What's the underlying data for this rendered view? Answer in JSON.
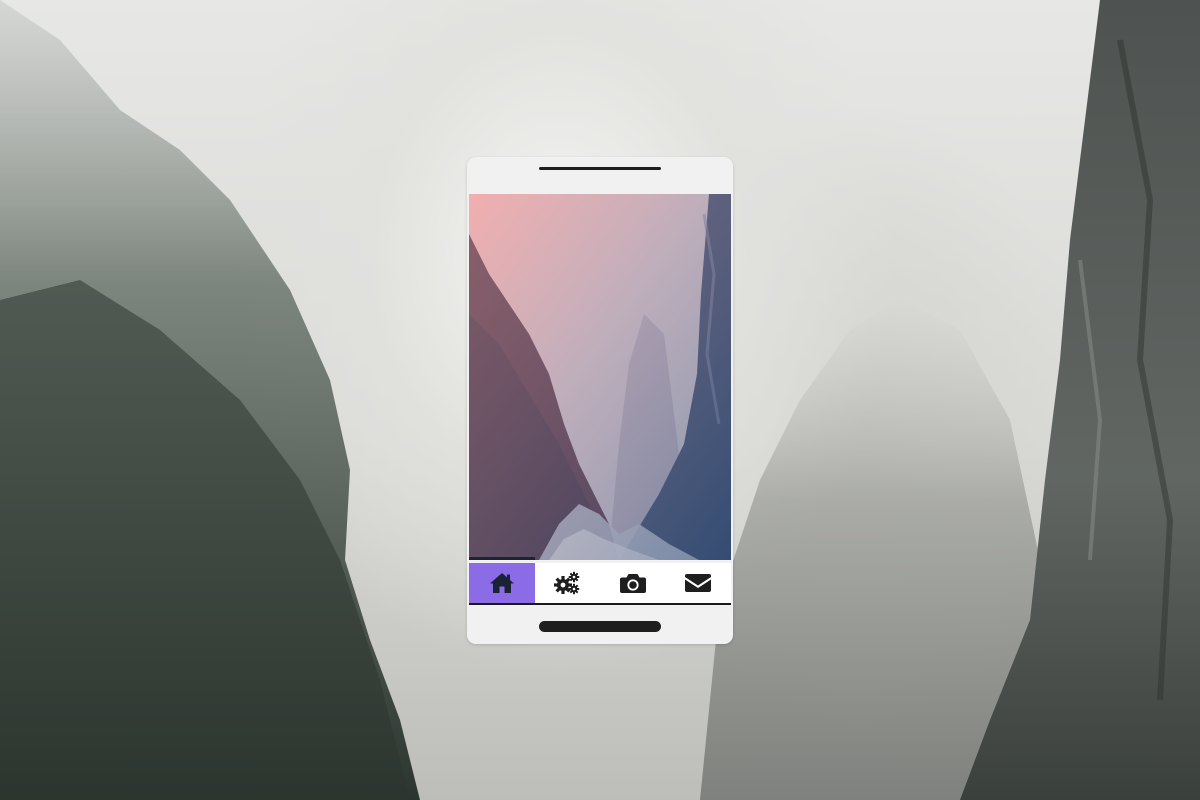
{
  "background": {
    "description_icon": "misty-canyon-photo"
  },
  "phone": {
    "screen_image_icon": "canyon-gradient-photo",
    "progress_fraction": 0.25,
    "nav": {
      "active_index": 0,
      "accent_color": "#8b6be6",
      "items": [
        {
          "icon": "home-icon"
        },
        {
          "icon": "gears-icon"
        },
        {
          "icon": "camera-icon"
        },
        {
          "icon": "envelope-icon"
        }
      ]
    }
  }
}
